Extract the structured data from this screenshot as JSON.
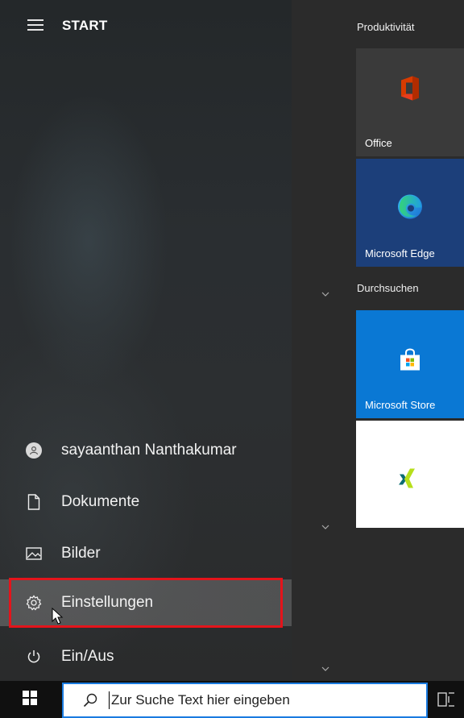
{
  "header": {
    "title": "START"
  },
  "left_menu": {
    "user": "sayaanthan Nanthakumar",
    "documents": "Dokumente",
    "pictures": "Bilder",
    "settings": "Einstellungen",
    "power": "Ein/Aus"
  },
  "tile_groups": {
    "productivity": "Produktivität",
    "browse": "Durchsuchen"
  },
  "tiles": {
    "office": "Office",
    "edge": "Microsoft Edge",
    "store": "Microsoft Store",
    "xing": ""
  },
  "taskbar": {
    "search_placeholder": "Zur Suche Text hier eingeben"
  },
  "icons": {
    "menu": "hamburger-icon",
    "user": "user-avatar-icon",
    "documents": "document-icon",
    "pictures": "pictures-icon",
    "settings": "gear-icon",
    "power": "power-icon",
    "windows": "windows-logo-icon",
    "search": "search-icon",
    "taskview": "task-view-icon"
  },
  "colors": {
    "highlight_border": "#e4141b",
    "search_border": "#1a7be0",
    "edge_tile": "#1c3f7a",
    "store_tile": "#0a78d4"
  }
}
